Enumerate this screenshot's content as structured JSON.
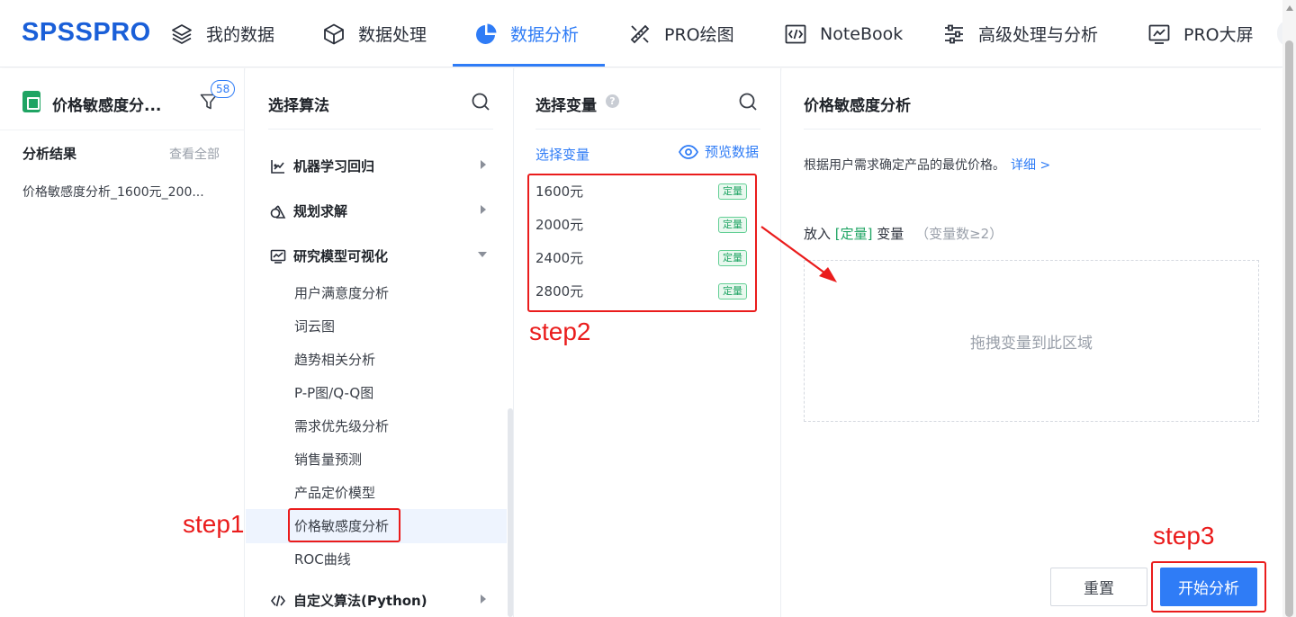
{
  "app": {
    "logo": "SPSSPRO",
    "nav": [
      {
        "label": "我的数据",
        "icon": "layers-icon"
      },
      {
        "label": "数据处理",
        "icon": "cube-icon"
      },
      {
        "label": "数据分析",
        "icon": "pie-chart-icon",
        "active": true
      },
      {
        "label": "PRO绘图",
        "icon": "drawing-tools-icon"
      },
      {
        "label": "NoteBook",
        "icon": "code-icon"
      },
      {
        "label": "高级处理与分析",
        "icon": "sliders-icon"
      },
      {
        "label": "PRO大屏",
        "icon": "monitor-chart-icon"
      }
    ],
    "accent_color": "#2f7cf6"
  },
  "left_panel": {
    "file_title": "价格敏感度分...",
    "filter_badge": "58",
    "results_title": "分析结果",
    "view_all": "查看全部",
    "result_item": "价格敏感度分析_1600元_200..."
  },
  "algo_panel": {
    "title": "选择算法",
    "categories": [
      {
        "label": "机器学习回归",
        "icon": "regression-chart-icon",
        "expanded": false
      },
      {
        "label": "规划求解",
        "icon": "planning-icon",
        "expanded": false
      },
      {
        "label": "研究模型可视化",
        "icon": "visual-chart-icon",
        "expanded": true
      },
      {
        "label": "自定义算法(Python)",
        "icon": "code-icon",
        "expanded": false
      }
    ],
    "sub_items": [
      "用户满意度分析",
      "词云图",
      "趋势相关分析",
      "P-P图/Q-Q图",
      "需求优先级分析",
      "销售量预测",
      "产品定价模型",
      "价格敏感度分析",
      "ROC曲线"
    ],
    "selected": "价格敏感度分析"
  },
  "var_panel": {
    "title": "选择变量",
    "help": "?",
    "select_var": "选择变量",
    "preview": "预览数据",
    "variables": [
      {
        "name": "1600元",
        "type": "定量"
      },
      {
        "name": "2000元",
        "type": "定量"
      },
      {
        "name": "2400元",
        "type": "定量"
      },
      {
        "name": "2800元",
        "type": "定量"
      }
    ]
  },
  "config_panel": {
    "title": "价格敏感度分析",
    "description": "根据用户需求确定产品的最优价格。",
    "detail_link": "详细 >",
    "put_prefix": "放入",
    "put_type": "[定量]",
    "put_suffix": "变量",
    "put_hint": "（变量数≥2）",
    "dropzone": "拖拽变量到此区域",
    "reset": "重置",
    "start": "开始分析"
  },
  "annotations": {
    "step1": "step1",
    "step2": "step2",
    "step3": "step3",
    "color": "#ea1c1c"
  }
}
